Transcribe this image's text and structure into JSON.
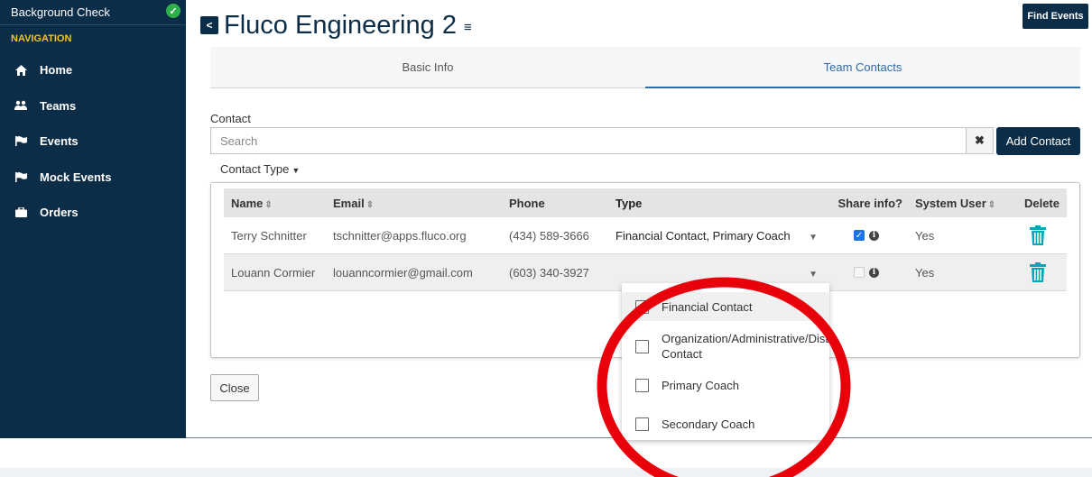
{
  "sidebar": {
    "background_check": "Background Check",
    "navigation_header": "NAVIGATION",
    "items": [
      {
        "label": "Home",
        "icon": "home-icon"
      },
      {
        "label": "Teams",
        "icon": "users-icon"
      },
      {
        "label": "Events",
        "icon": "flag-icon"
      },
      {
        "label": "Mock Events",
        "icon": "flag-icon"
      },
      {
        "label": "Orders",
        "icon": "briefcase-icon"
      }
    ]
  },
  "header": {
    "back_label": "<",
    "title": "Fluco Engineering 2",
    "find_events": "Find Events"
  },
  "tabs": [
    {
      "label": "Basic Info",
      "active": false
    },
    {
      "label": "Team Contacts",
      "active": true
    }
  ],
  "contact": {
    "label": "Contact",
    "search_placeholder": "Search",
    "add_contact": "Add Contact",
    "contact_type": "Contact Type"
  },
  "table": {
    "headers": {
      "name": "Name",
      "email": "Email",
      "phone": "Phone",
      "type": "Type",
      "share": "Share info?",
      "system_user": "System User",
      "delete": "Delete"
    },
    "rows": [
      {
        "name": "Terry Schnitter",
        "email": "tschnitter@apps.fluco.org",
        "phone": "(434) 589-3666",
        "type": "Financial Contact, Primary Coach",
        "share": true,
        "system_user": "Yes"
      },
      {
        "name": "Louann Cormier",
        "email": "louanncormier@gmail.com",
        "phone": "(603) 340-3927",
        "type": "",
        "share": false,
        "system_user": "Yes"
      }
    ]
  },
  "dropdown": {
    "options": [
      {
        "label": "Financial Contact",
        "highlighted": true
      },
      {
        "label": "Organization/Administrative/Dist Contact",
        "highlighted": false
      },
      {
        "label": "Primary Coach",
        "highlighted": false
      },
      {
        "label": "Secondary Coach",
        "highlighted": false
      }
    ]
  },
  "close_label": "Close",
  "colors": {
    "navy": "#0c2d48",
    "accent_blue": "#2f6aa5",
    "trash": "#0aa5b8",
    "annotation_red": "#e8000b",
    "nav_header": "#f3c423"
  }
}
